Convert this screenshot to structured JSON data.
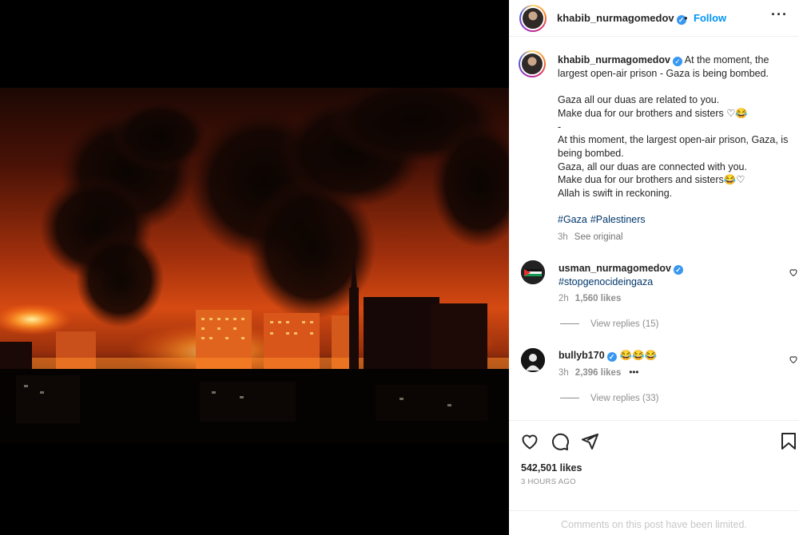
{
  "post": {
    "author": "khabib_nurmagomedov",
    "follow_label": "Follow",
    "separator": "•",
    "more_label": "···",
    "verified_glyph": "✓"
  },
  "caption": {
    "username": "khabib_nurmagomedov",
    "text": " At the moment, the largest open-air prison - Gaza is being bombed.\n\nGaza all our duas are related to you.\nMake dua for our brothers and sisters ♡😂\n-\nAt this moment, the largest open-air prison, Gaza, is being bombed.\nGaza, all our duas are connected with you.\nMake dua for our brothers and sisters😂♡\nAllah is swift in reckoning.",
    "hashtags": [
      "#Gaza",
      "#Palestiners"
    ],
    "time": "3h",
    "see_original": "See original"
  },
  "comments": [
    {
      "username": "usman_nurmagomedov",
      "text": "#stopgenocideingaza",
      "time": "2h",
      "likes": "1,560 likes",
      "view_replies": "View replies (15)"
    },
    {
      "username": "bullyb170",
      "text": "😂😂😂",
      "time": "3h",
      "likes": "2,396 likes",
      "more": "•••",
      "view_replies": "View replies (33)"
    }
  ],
  "actions": {
    "likes": "542,501 likes",
    "posted": "3 HOURS AGO",
    "limited_notice": "Comments on this post have been limited."
  },
  "icons": {
    "like": "heart-icon",
    "comment": "comment-icon",
    "share": "paper-plane-icon",
    "save": "bookmark-icon",
    "verified": "verified-badge-icon"
  },
  "colors": {
    "link_blue": "#0095f6",
    "hashtag_blue": "#00376b",
    "verified_blue": "#3897f0",
    "muted_gray": "#8e8e8e"
  }
}
